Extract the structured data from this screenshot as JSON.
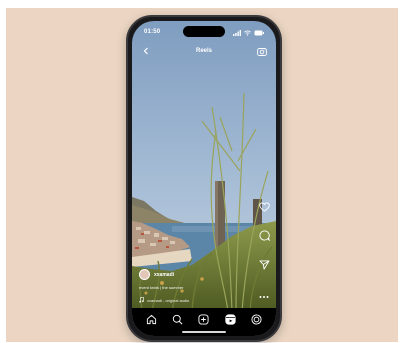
{
  "status_bar": {
    "time": "01:50",
    "icons": [
      "signal-icon",
      "wifi-icon",
      "battery-icon"
    ]
  },
  "top_nav": {
    "back_icon": "chevron-left-icon",
    "title": "Reels",
    "camera_icon": "camera-icon"
  },
  "side_actions": [
    "heart-icon",
    "comment-icon",
    "send-icon",
    "more-icon",
    "audio-thumbnail"
  ],
  "post": {
    "username": "xxamadi",
    "caption": "event twink | the summer",
    "audio": "xxamadi - original audio"
  },
  "tab_bar": [
    "home-icon",
    "search-icon",
    "create-icon",
    "reels-icon",
    "profile-icon"
  ],
  "colors": {
    "backdrop": "#ecd6c3",
    "phone_frame": "#1a1a1c",
    "sky": "#9fb5d0",
    "sea": "#5c86a8"
  }
}
